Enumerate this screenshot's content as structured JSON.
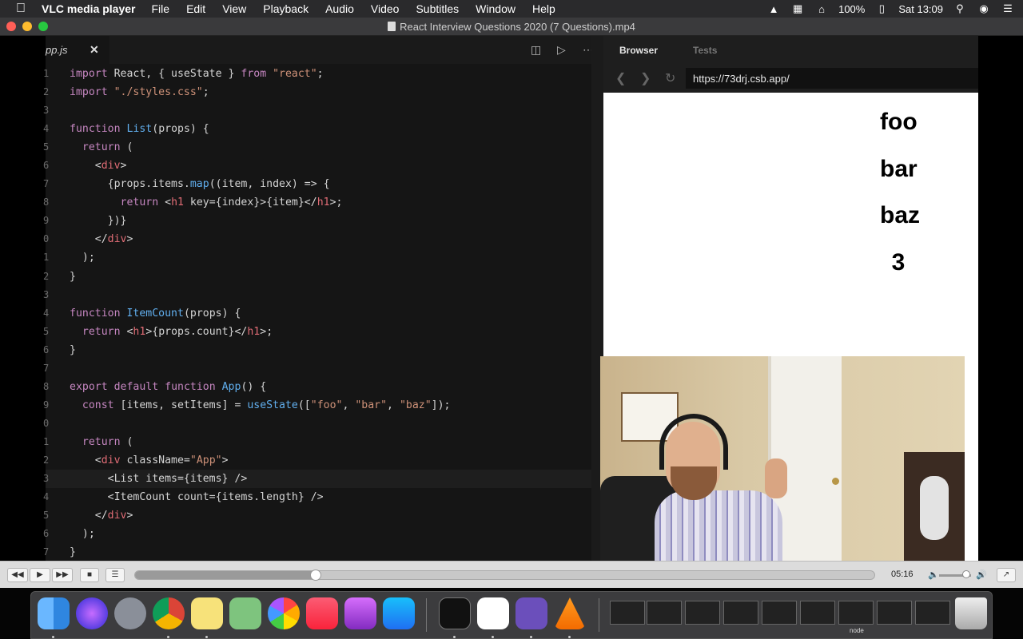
{
  "menubar": {
    "app_name": "VLC media player",
    "menus": [
      "File",
      "Edit",
      "View",
      "Playback",
      "Audio",
      "Video",
      "Subtitles",
      "Window",
      "Help"
    ],
    "battery": "100%",
    "clock": "Sat 13:09"
  },
  "window": {
    "title": "React Interview Questions 2020 (7 Questions).mp4"
  },
  "editor": {
    "tab_label": "pp.js",
    "lines": [
      {
        "n": "1",
        "t": "import React, { useState } from \"react\";"
      },
      {
        "n": "2",
        "t": "import \"./styles.css\";"
      },
      {
        "n": "3",
        "t": ""
      },
      {
        "n": "4",
        "t": "function List(props) {"
      },
      {
        "n": "5",
        "t": "  return ("
      },
      {
        "n": "6",
        "t": "    <div>"
      },
      {
        "n": "7",
        "t": "      {props.items.map((item, index) => {"
      },
      {
        "n": "8",
        "t": "        return <h1 key={index}>{item}</h1>;"
      },
      {
        "n": "9",
        "t": "      })}"
      },
      {
        "n": "0",
        "t": "    </div>"
      },
      {
        "n": "1",
        "t": "  );"
      },
      {
        "n": "2",
        "t": "}"
      },
      {
        "n": "3",
        "t": ""
      },
      {
        "n": "4",
        "t": "function ItemCount(props) {"
      },
      {
        "n": "5",
        "t": "  return <h1>{props.count}</h1>;"
      },
      {
        "n": "6",
        "t": "}"
      },
      {
        "n": "7",
        "t": ""
      },
      {
        "n": "8",
        "t": "export default function App() {"
      },
      {
        "n": "9",
        "t": "  const [items, setItems] = useState([\"foo\", \"bar\", \"baz\"]);"
      },
      {
        "n": "0",
        "t": ""
      },
      {
        "n": "1",
        "t": "  return ("
      },
      {
        "n": "2",
        "t": "    <div className=\"App\">"
      },
      {
        "n": "3",
        "t": "      <List items={items} />"
      },
      {
        "n": "4",
        "t": "      <ItemCount count={items.length} />"
      },
      {
        "n": "5",
        "t": "    </div>"
      },
      {
        "n": "6",
        "t": "  );"
      },
      {
        "n": "7",
        "t": "}"
      }
    ]
  },
  "preview": {
    "tabs": [
      "Browser",
      "Tests"
    ],
    "url": "https://73drj.csb.app/",
    "rendered_items": [
      "foo",
      "bar",
      "baz",
      "3"
    ]
  },
  "player": {
    "time": "05:16",
    "progress": 0.244,
    "volume": 0.85
  },
  "dock": {
    "node_label": "node"
  }
}
